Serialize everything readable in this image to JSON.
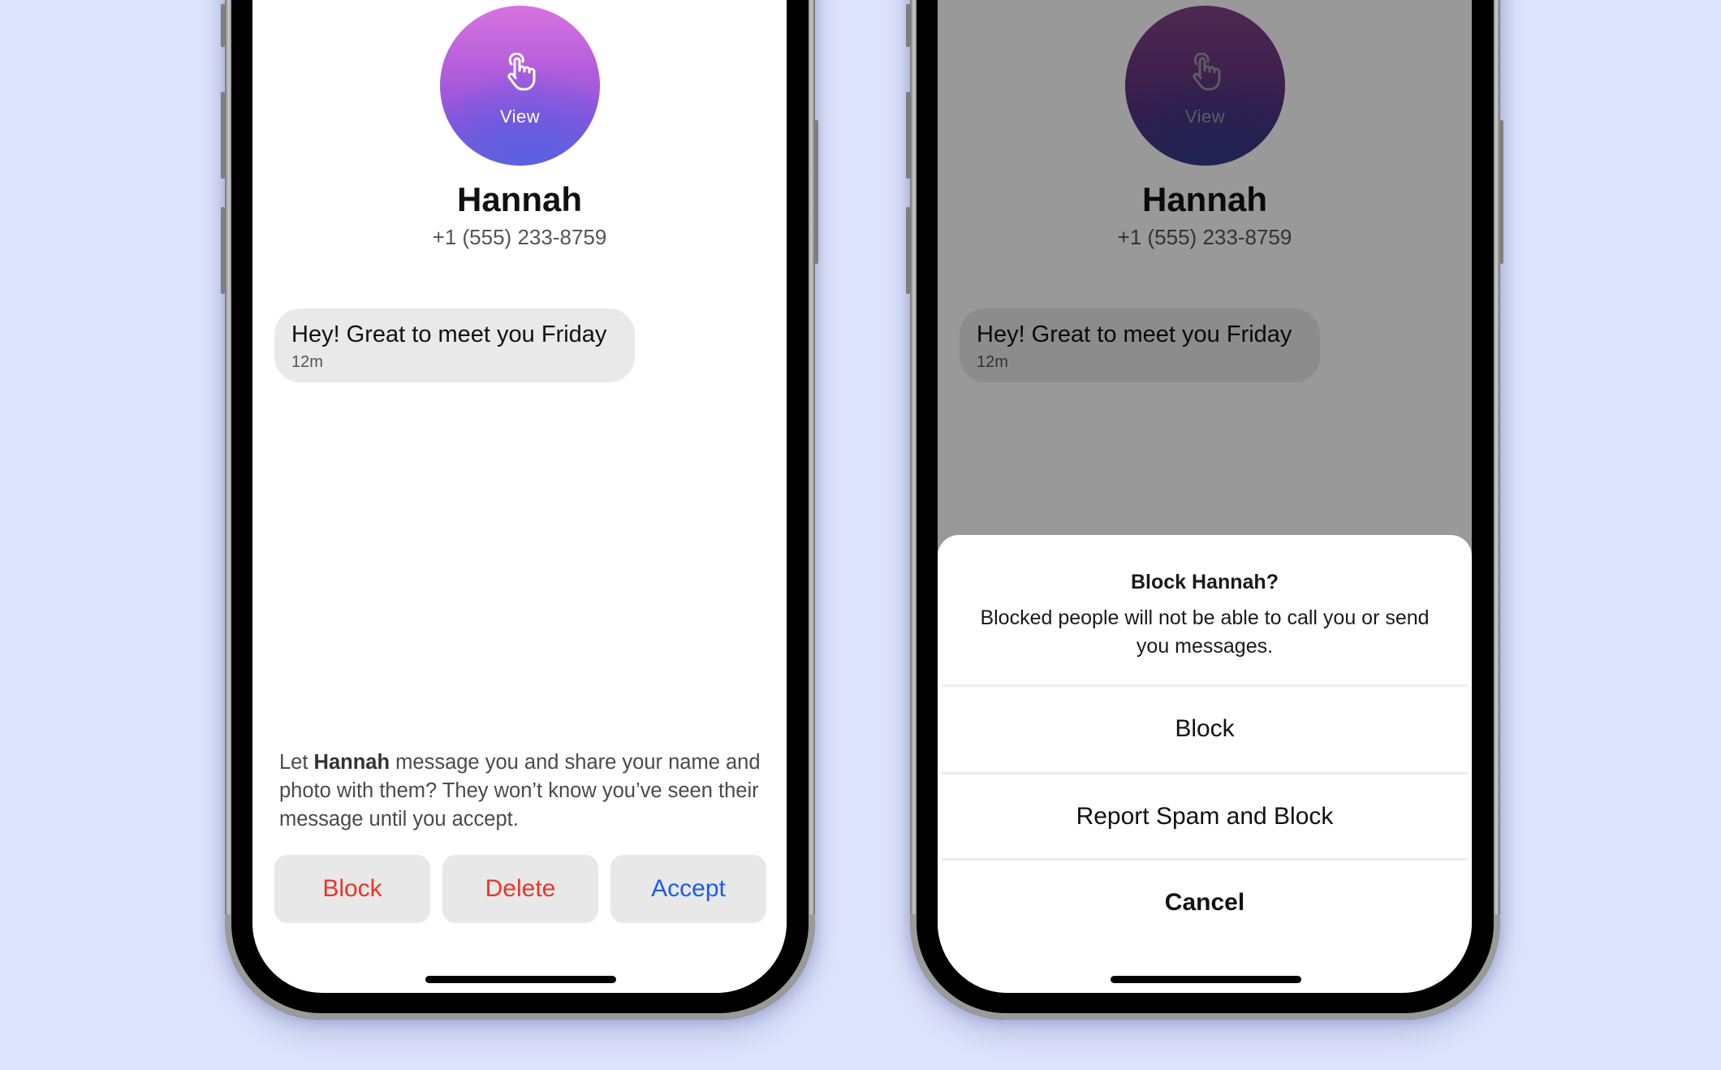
{
  "colors": {
    "background": "#e0e5fe",
    "danger": "#e8352a",
    "accent": "#1a5cf0",
    "button_bg": "#e8e8e8",
    "overlay": "#9a9a9a"
  },
  "contact": {
    "avatar_action_label": "View",
    "avatar_icon": "hand-pointer-icon",
    "name": "Hannah",
    "phone": "+1 (555) 233-8759"
  },
  "message": {
    "text": "Hey! Great to meet you Friday",
    "time": "12m"
  },
  "request": {
    "prefix": "Let ",
    "name": "Hannah",
    "suffix": " message you and share your name and photo with them? They won’t know you’ve seen their message until you accept.",
    "buttons": {
      "block": "Block",
      "delete": "Delete",
      "accept": "Accept"
    }
  },
  "block_sheet": {
    "title": "Block Hannah?",
    "body": "Blocked people will not be able to call you or send you messages.",
    "options": {
      "block": "Block",
      "report": "Report Spam and Block",
      "cancel": "Cancel"
    }
  }
}
